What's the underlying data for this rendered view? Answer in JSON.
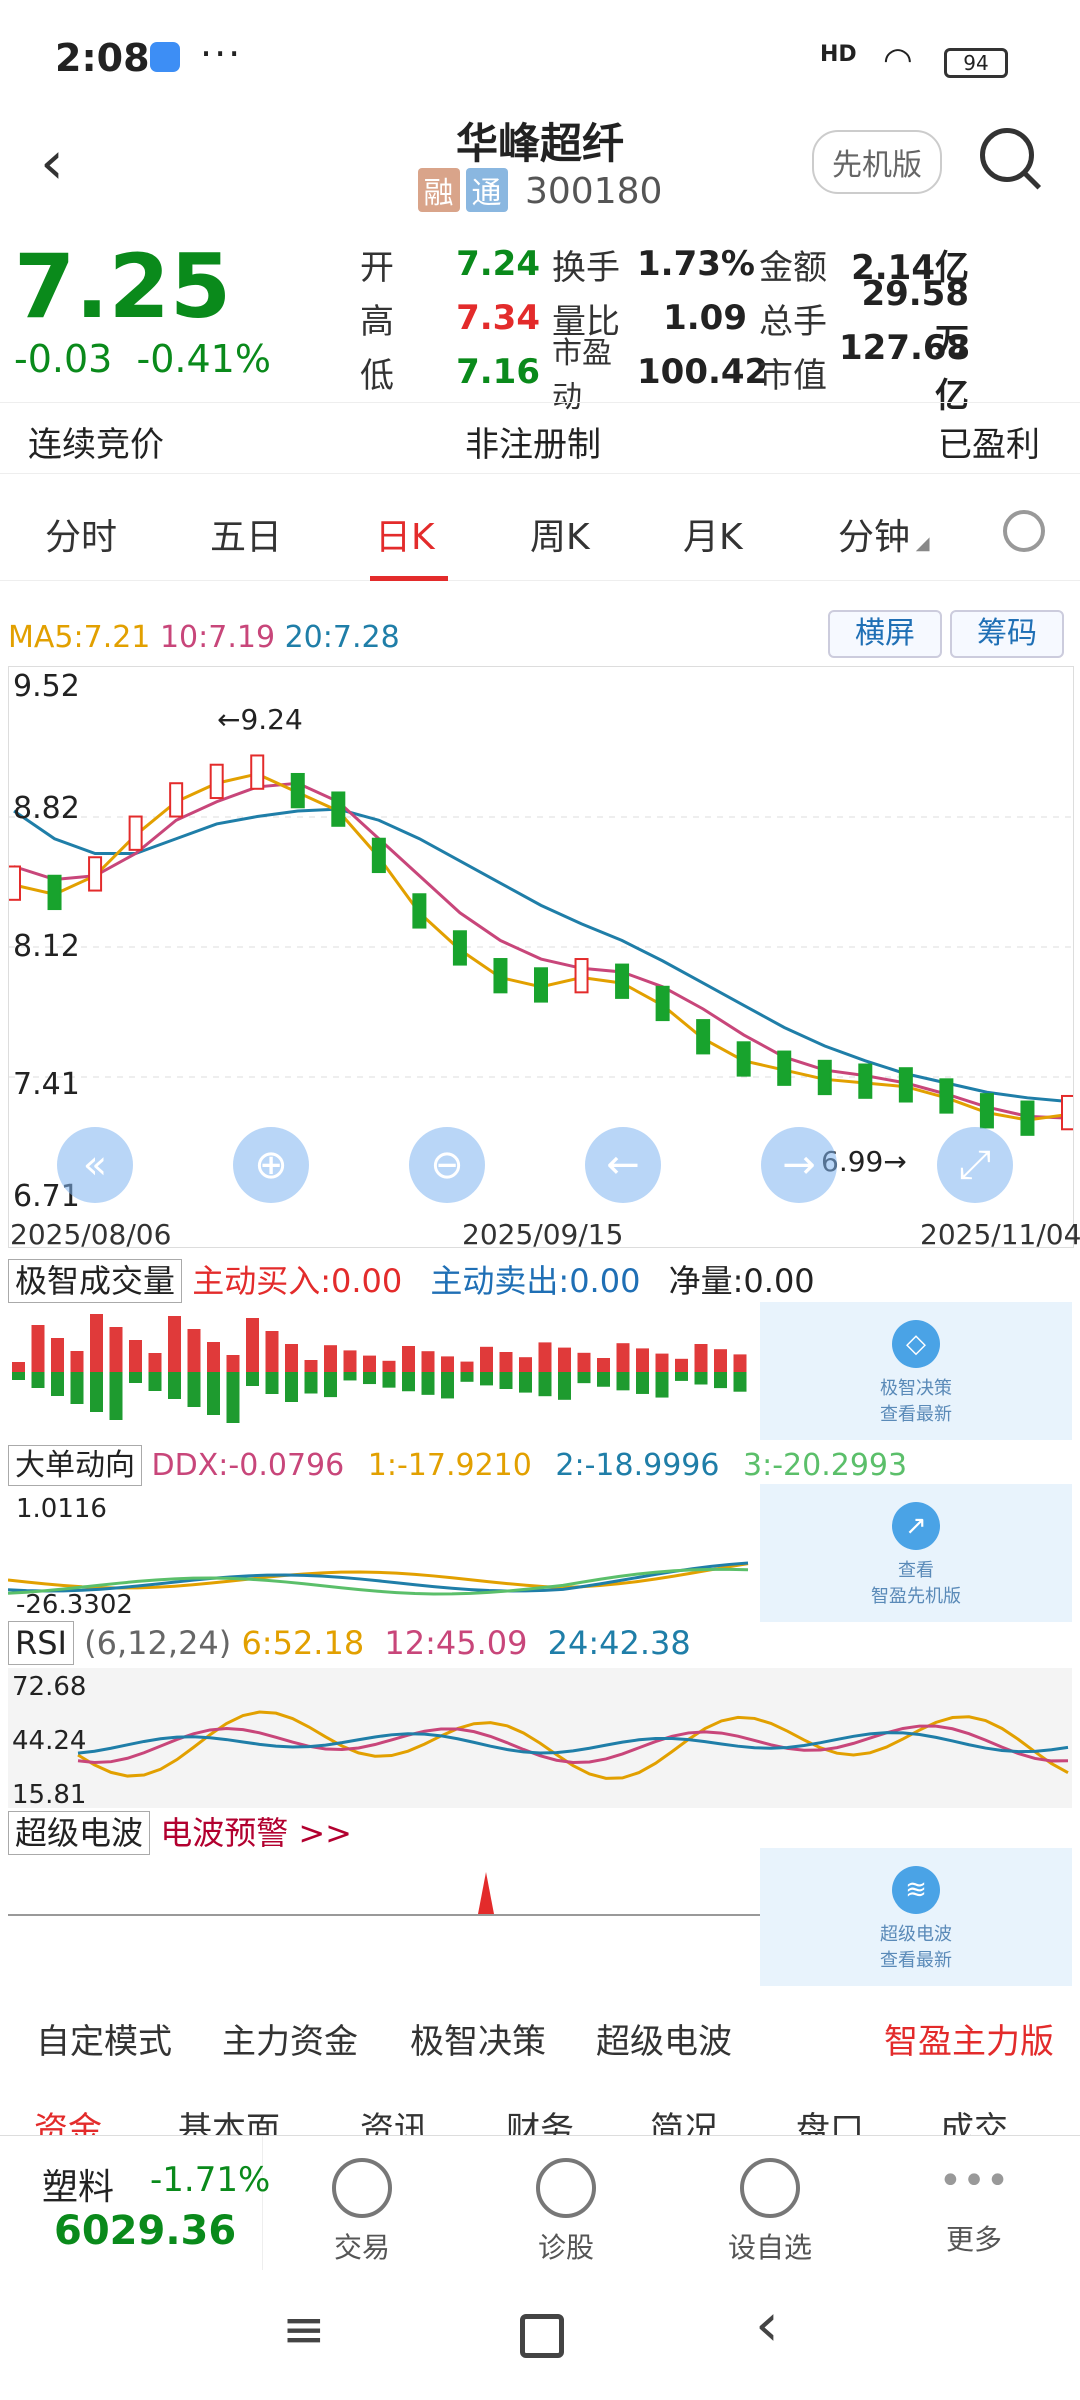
{
  "status": {
    "time": "2:08",
    "dots": "···",
    "battery": "94",
    "hd": "HD"
  },
  "header": {
    "title": "华峰超纤",
    "tag_rong": "融",
    "tag_tong": "通",
    "code": "300180",
    "mode_button": "先机版"
  },
  "quote": {
    "price": "7.25",
    "change": "-0.03",
    "change_pct": "-0.41%",
    "rows": [
      {
        "l1": "开",
        "v1": "7.24",
        "c1": "green",
        "l2": "换手",
        "v2": "1.73%",
        "l3": "金额",
        "v3": "2.14亿"
      },
      {
        "l1": "高",
        "v1": "7.34",
        "c1": "red",
        "l2": "量比",
        "v2": "1.09",
        "l3": "总手",
        "v3": "29.58万"
      },
      {
        "l1": "低",
        "v1": "7.16",
        "c1": "green",
        "l2": "市盈动",
        "v2": "100.42",
        "l3": "市值",
        "v3": "127.68亿"
      }
    ]
  },
  "info": {
    "left": "连续竞价",
    "center": "非注册制",
    "right": "已盈利"
  },
  "tabs": [
    "分时",
    "五日",
    "日K",
    "周K",
    "月K",
    "分钟"
  ],
  "ma": {
    "ma5": "MA5:7.21",
    "ma10": "10:7.19",
    "ma20": "20:7.28",
    "btn_landscape": "横屏",
    "btn_chips": "筹码"
  },
  "chart_data": {
    "type": "candlestick",
    "y_ticks": [
      "9.52",
      "8.82",
      "8.12",
      "7.41",
      "6.71"
    ],
    "ylim": [
      6.71,
      9.52
    ],
    "x_labels": [
      "2025/08/06",
      "2025/09/15",
      "2025/11/04"
    ],
    "annotations": [
      "←9.24",
      "6.99→"
    ],
    "series_ma5": [
      8.45,
      8.4,
      8.5,
      8.72,
      8.9,
      9.0,
      9.05,
      8.95,
      8.85,
      8.6,
      8.3,
      8.1,
      7.95,
      7.9,
      7.95,
      7.92,
      7.8,
      7.62,
      7.5,
      7.45,
      7.4,
      7.38,
      7.36,
      7.3,
      7.22,
      7.18,
      7.21
    ],
    "series_ma10": [
      8.55,
      8.48,
      8.5,
      8.62,
      8.8,
      8.9,
      8.98,
      9.0,
      8.9,
      8.7,
      8.5,
      8.3,
      8.15,
      8.05,
      8.0,
      7.98,
      7.9,
      7.78,
      7.64,
      7.52,
      7.45,
      7.42,
      7.38,
      7.32,
      7.25,
      7.2,
      7.19
    ],
    "series_ma20": [
      8.85,
      8.7,
      8.62,
      8.62,
      8.7,
      8.78,
      8.82,
      8.85,
      8.86,
      8.8,
      8.7,
      8.58,
      8.46,
      8.34,
      8.24,
      8.15,
      8.04,
      7.92,
      7.8,
      7.68,
      7.58,
      7.5,
      7.43,
      7.38,
      7.33,
      7.3,
      7.28
    ]
  },
  "controls": [
    "«",
    "⊕",
    "⊖",
    "←",
    "→",
    "⤢"
  ],
  "vol": {
    "name": "极智成交量",
    "buy": "主动买入:0.00",
    "sell": "主动卖出:0.00",
    "net": "净量:0.00",
    "card1": "极智决策",
    "card2": "查看最新"
  },
  "ddx": {
    "name": "大单动向",
    "ddx": "DDX:-0.0796",
    "v1": "1:-17.9210",
    "v2": "2:-18.9996",
    "v3": "3:-20.2993",
    "top": "1.0116",
    "bottom": "-26.3302",
    "card1": "查看",
    "card2": "智盈先机版"
  },
  "rsi": {
    "name": "RSI",
    "params": "(6,12,24)",
    "r6": "6:52.18",
    "r12": "12:45.09",
    "r24": "24:42.38",
    "t1": "72.68",
    "t2": "44.24",
    "t3": "15.81"
  },
  "wave": {
    "name": "超级电波",
    "alert": "电波预警 >>",
    "card1": "超级电波",
    "card2": "查看最新"
  },
  "modes": {
    "m1": "自定模式",
    "m2": "主力资金",
    "m3": "极智决策",
    "m4": "超级电波",
    "m5": "智盈主力版"
  },
  "subtabs": [
    "资金",
    "基本面",
    "资讯",
    "财务",
    "简况",
    "盘口",
    "成交"
  ],
  "bottom": {
    "index_name": "塑料",
    "index_pct": "-1.71%",
    "index_val": "6029.36",
    "items": [
      "交易",
      "诊股",
      "设自选",
      "更多"
    ]
  }
}
